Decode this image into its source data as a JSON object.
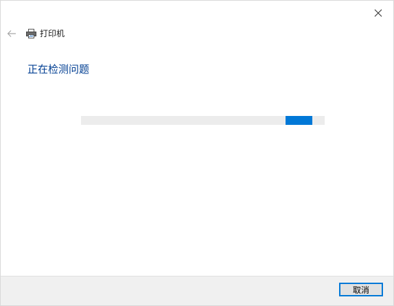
{
  "window": {
    "close_icon": "close-icon"
  },
  "header": {
    "back_icon": "back-arrow-icon",
    "app_icon": "printer-icon",
    "title": "打印机"
  },
  "main": {
    "heading": "正在检测问题",
    "progress": {
      "state": "indeterminate",
      "indicator_start_fraction": 0.84,
      "indicator_end_fraction": 0.95,
      "fill_color": "#0078d7",
      "track_color": "#ececec"
    }
  },
  "footer": {
    "cancel_label": "取消"
  },
  "colors": {
    "heading": "#003e92",
    "accent": "#0078d7",
    "footer_bg": "#f0f0f0"
  }
}
